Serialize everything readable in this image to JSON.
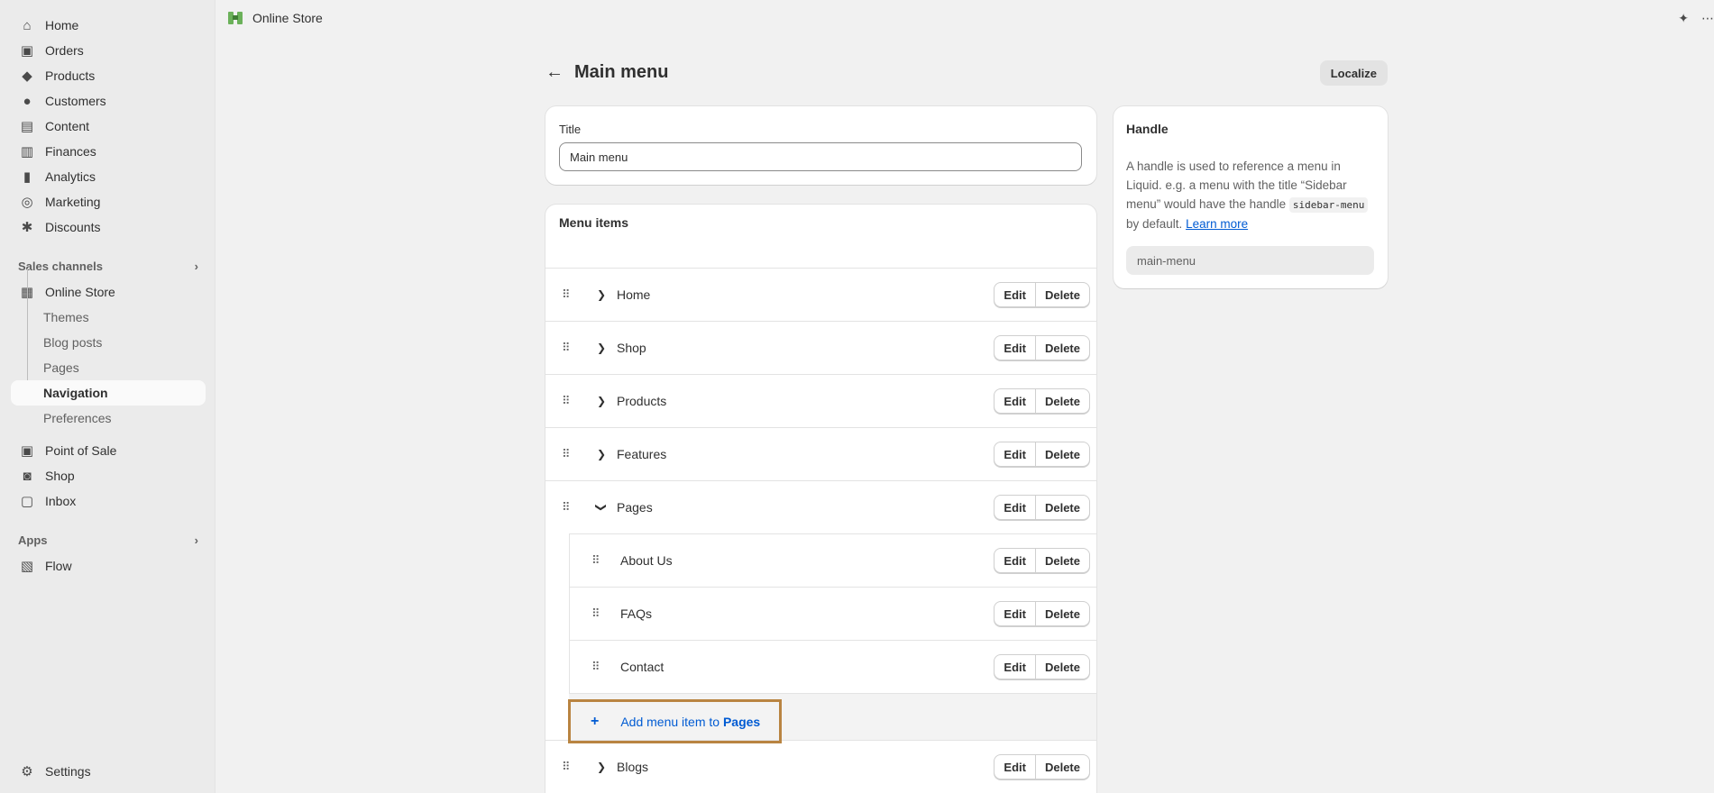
{
  "sidebar": {
    "main_items": [
      {
        "label": "Home",
        "icon": "home-icon"
      },
      {
        "label": "Orders",
        "icon": "orders-icon"
      },
      {
        "label": "Products",
        "icon": "tag-icon"
      },
      {
        "label": "Customers",
        "icon": "person-icon"
      },
      {
        "label": "Content",
        "icon": "content-icon"
      },
      {
        "label": "Finances",
        "icon": "bank-icon"
      },
      {
        "label": "Analytics",
        "icon": "bar-chart-icon"
      },
      {
        "label": "Marketing",
        "icon": "target-icon"
      },
      {
        "label": "Discounts",
        "icon": "discount-icon"
      }
    ],
    "sales_channels_label": "Sales channels",
    "online_store_label": "Online Store",
    "online_store_sub": [
      "Themes",
      "Blog posts",
      "Pages",
      "Navigation",
      "Preferences"
    ],
    "channels": [
      {
        "label": "Point of Sale",
        "icon": "pos-icon"
      },
      {
        "label": "Shop",
        "icon": "shop-icon"
      },
      {
        "label": "Inbox",
        "icon": "inbox-icon"
      }
    ],
    "apps_label": "Apps",
    "apps": [
      {
        "label": "Flow",
        "icon": "flow-icon"
      }
    ],
    "settings_label": "Settings"
  },
  "topbar": {
    "title": "Online Store"
  },
  "page": {
    "title": "Main menu",
    "localize_label": "Localize"
  },
  "title_card": {
    "label": "Title",
    "value": "Main menu"
  },
  "menu": {
    "heading": "Menu items",
    "edit_label": "Edit",
    "delete_label": "Delete",
    "items": [
      "Home",
      "Shop",
      "Products",
      "Features",
      "Pages"
    ],
    "children": [
      "About Us",
      "FAQs",
      "Contact"
    ],
    "add_prefix": "Add menu item to",
    "add_target": "Pages",
    "after": [
      "Blogs"
    ]
  },
  "handle": {
    "title": "Handle",
    "desc_1": "A handle is used to reference a menu in Liquid. e.g. a menu with the title “Sidebar menu” would have the handle",
    "code": "sidebar-menu",
    "desc_2": "by default.",
    "link": "Learn more",
    "value": "main-menu"
  },
  "colors": {
    "accent": "#005bd3",
    "highlight_border": "#b98441"
  }
}
